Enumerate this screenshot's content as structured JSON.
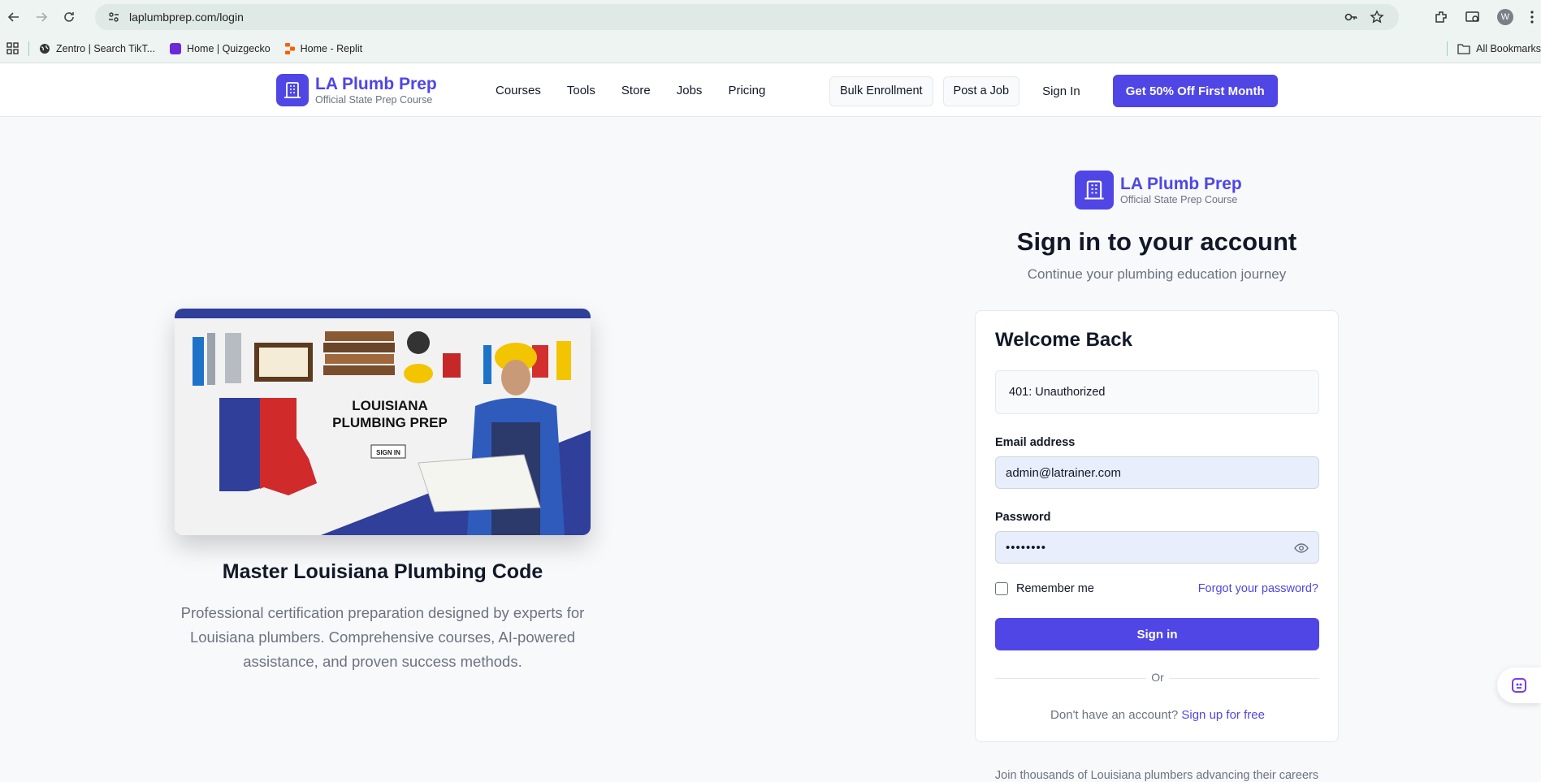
{
  "browser": {
    "url": "laplumbprep.com/login",
    "avatar_letter": "W",
    "bookmarks": [
      {
        "label": "Zentro | Search TikT..."
      },
      {
        "label": "Home | Quizgecko"
      },
      {
        "label": "Home - Replit"
      }
    ],
    "all_bookmarks_label": "All Bookmarks"
  },
  "header": {
    "brand_name": "LA Plumb Prep",
    "brand_tagline": "Official State Prep Course",
    "nav": [
      "Courses",
      "Tools",
      "Store",
      "Jobs",
      "Pricing"
    ],
    "bulk_enrollment": "Bulk Enrollment",
    "post_job": "Post a Job",
    "sign_in": "Sign In",
    "cta": "Get 50% Off First Month"
  },
  "hero": {
    "image_title_line1": "LOUISIANA",
    "image_title_line2": "PLUMBING PREP",
    "image_button": "SIGN IN",
    "title": "Master Louisiana Plumbing Code",
    "description": "Professional certification preparation designed by experts for Louisiana plumbers. Comprehensive courses, AI-powered assistance, and proven success methods."
  },
  "auth": {
    "brand_name": "LA Plumb Prep",
    "brand_tagline": "Official State Prep Course",
    "title": "Sign in to your account",
    "subtitle": "Continue your plumbing education journey",
    "card_title": "Welcome Back",
    "error": "401: Unauthorized",
    "email_label": "Email address",
    "email_value": "admin@latrainer.com",
    "password_label": "Password",
    "password_masked": "••••••••",
    "remember_label": "Remember me",
    "forgot_label": "Forgot your password?",
    "submit_label": "Sign in",
    "divider_label": "Or",
    "no_account": "Don't have an account?",
    "signup_link": "Sign up for free",
    "footer_note": "Join thousands of Louisiana plumbers advancing their careers"
  },
  "colors": {
    "brand": "#4f46e5",
    "muted": "#6b7280",
    "louisiana_blue": "#2f3f9a",
    "louisiana_red": "#d12a2a"
  }
}
